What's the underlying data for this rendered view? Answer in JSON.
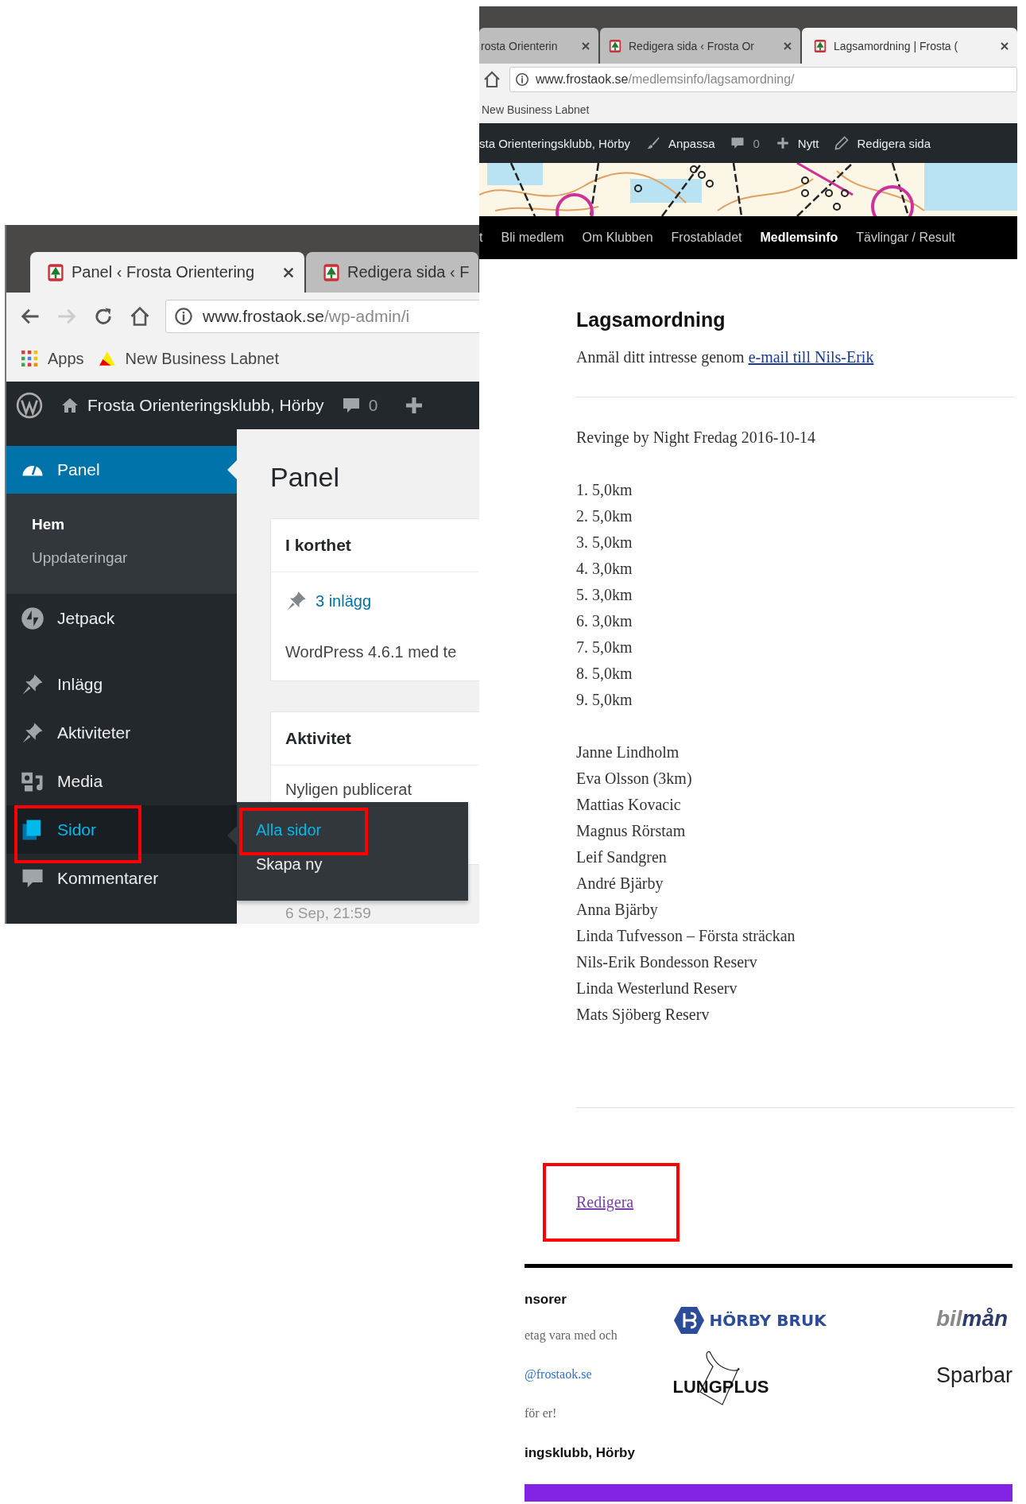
{
  "left_window": {
    "tabs": [
      {
        "title": "Panel ‹ Frosta Orientering",
        "selected": true
      },
      {
        "title": "Redigera sida ‹ F",
        "selected": false
      }
    ],
    "address": {
      "domain": "www.frostaok.se",
      "path": "/wp-admin/i"
    },
    "bookmarks": [
      "Apps",
      "New Business Labnet"
    ],
    "admin_bar": {
      "site": "Frosta Orienteringsklubb, Hörby",
      "comments": "0"
    },
    "sidebar": [
      {
        "label": "Panel",
        "current": true,
        "hovered": false,
        "highlighted": false,
        "children": [
          {
            "label": "Hem",
            "selected": true
          },
          {
            "label": "Uppdateringar",
            "selected": false
          }
        ]
      },
      {
        "label": "Jetpack",
        "current": false,
        "hovered": false,
        "highlighted": false
      },
      {
        "label": "Inlägg",
        "current": false,
        "hovered": false,
        "highlighted": false
      },
      {
        "label": "Aktiviteter",
        "current": false,
        "hovered": false,
        "highlighted": false
      },
      {
        "label": "Media",
        "current": false,
        "hovered": false,
        "highlighted": false
      },
      {
        "label": "Sidor",
        "current": false,
        "hovered": true,
        "highlighted": true,
        "flyout": [
          {
            "label": "Alla sidor",
            "hovered": true,
            "highlighted": true
          },
          {
            "label": "Skapa ny",
            "hovered": false,
            "highlighted": false
          }
        ]
      },
      {
        "label": "Kommentarer",
        "current": false,
        "hovered": false,
        "highlighted": false
      }
    ],
    "page_title": "Panel",
    "cards": [
      {
        "title": "I korthet",
        "rows": [
          {
            "kind": "link",
            "text": "3 inlägg"
          },
          {
            "kind": "text",
            "text": "WordPress 4.6.1 med te"
          }
        ]
      },
      {
        "title": "Aktivitet",
        "rows": [
          {
            "kind": "text",
            "text": "Nyligen publicerat"
          },
          {
            "kind": "muted",
            "text": "6 Sep, 21:59"
          }
        ]
      }
    ]
  },
  "right_window": {
    "tabs": [
      {
        "title": "rosta Orienterin",
        "selected": false
      },
      {
        "title": "Redigera sida ‹ Frosta Or",
        "selected": false
      },
      {
        "title": "Lagsamordning | Frosta (",
        "selected": true
      }
    ],
    "address": {
      "domain": "www.frostaok.se",
      "path": "/medlemsinfo/lagsamordning/"
    },
    "bookmarks": [
      "New Business Labnet"
    ],
    "admin_bar": {
      "site": "sta Orienteringsklubb, Hörby",
      "customize": "Anpassa",
      "comments": "0",
      "new": "Nytt",
      "edit": "Redigera sida"
    },
    "nav": [
      {
        "label": "t",
        "selected": false
      },
      {
        "label": "Bli medlem",
        "selected": false
      },
      {
        "label": "Om Klubben",
        "selected": false
      },
      {
        "label": "Frostabladet",
        "selected": false
      },
      {
        "label": "Medlemsinfo",
        "selected": true
      },
      {
        "label": "Tävlingar / Result",
        "selected": false
      }
    ],
    "content": {
      "title": "Lagsamordning",
      "intro": "Anmäl ditt intresse genom",
      "intro_link": "e-mail till Nils-Erik",
      "event": "Revinge by Night Fredag 2016-10-14",
      "legs": [
        "1. 5,0km",
        "2. 5,0km",
        "3. 5,0km",
        "4. 3,0km",
        "5. 3,0km",
        "6. 3,0km",
        "7. 5,0km",
        "8. 5,0km",
        "9. 5,0km"
      ],
      "names": [
        "Janne Lindholm",
        "Eva Olsson (3km)",
        "Mattias Kovacic",
        "Magnus Rörstam",
        "Leif Sandgren",
        "André Bjärby",
        "Anna Bjärby",
        "Linda Tufvesson – Första sträckan",
        "Nils-Erik Bondesson Reserv",
        "Linda Westerlund Reserv",
        "Mats Sjöberg Reserv"
      ],
      "edit_link": {
        "label": "Redigera",
        "highlighted": true
      }
    },
    "footer": {
      "heading": "nsorer",
      "lines": [
        {
          "kind": "text",
          "text": "etag vara med och"
        },
        {
          "kind": "link",
          "text": "@frostaok.se"
        },
        {
          "kind": "text",
          "text": "för er!"
        }
      ],
      "club": "ingsklubb, Hörby",
      "sponsors": [
        {
          "kind": "horby",
          "parts": [
            "HÖRBY BRUK"
          ]
        },
        {
          "kind": "lungplus",
          "parts": [
            "LUNGPLUS"
          ]
        },
        {
          "kind": "bilman",
          "parts": [
            "bil",
            "mån"
          ]
        },
        {
          "kind": "sparbank",
          "parts": [
            "Sparbar"
          ]
        }
      ]
    }
  }
}
